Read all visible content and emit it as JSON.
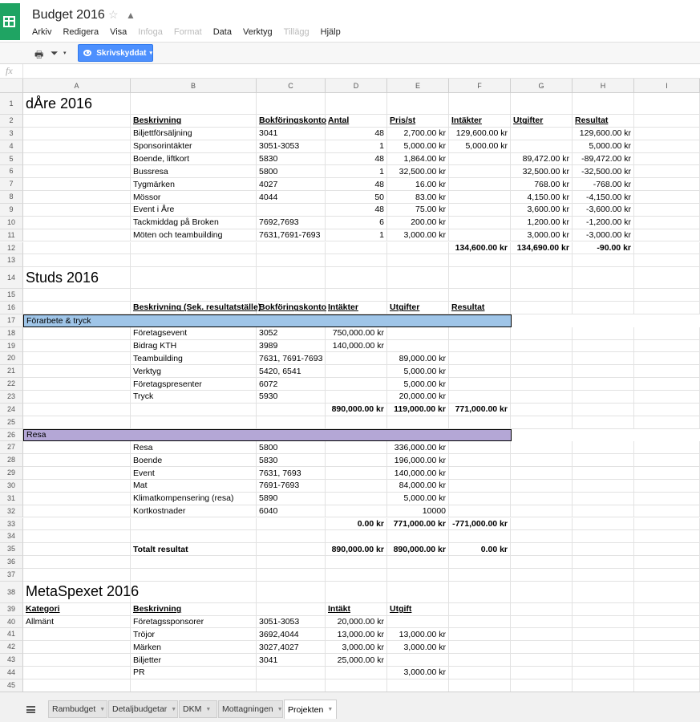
{
  "app": {
    "title": "Budget 2016"
  },
  "menu": [
    {
      "label": "Arkiv",
      "disabled": false
    },
    {
      "label": "Redigera",
      "disabled": false
    },
    {
      "label": "Visa",
      "disabled": false
    },
    {
      "label": "Infoga",
      "disabled": true
    },
    {
      "label": "Format",
      "disabled": true
    },
    {
      "label": "Data",
      "disabled": false
    },
    {
      "label": "Verktyg",
      "disabled": false
    },
    {
      "label": "Tillägg",
      "disabled": true
    },
    {
      "label": "Hjälp",
      "disabled": false
    }
  ],
  "toolbar": {
    "readonly_label": "Skrivskyddat"
  },
  "fx_label": "fx",
  "columns": [
    "A",
    "B",
    "C",
    "D",
    "E",
    "F",
    "G",
    "H",
    "I"
  ],
  "rows": {
    "1": {
      "A": "dÅre 2016"
    },
    "2": {
      "B": "Beskrivning",
      "C": "Bokföringskonto",
      "D": "Antal",
      "E": "Pris/st",
      "F": "Intäkter",
      "G": "Utgifter",
      "H": "Resultat"
    },
    "3": {
      "B": "Biljettförsäljning",
      "C": "3041",
      "D": "48",
      "E": "2,700.00 kr",
      "F": "129,600.00 kr",
      "H": "129,600.00 kr"
    },
    "4": {
      "B": "Sponsorintäkter",
      "C": "3051-3053",
      "D": "1",
      "E": "5,000.00 kr",
      "F": "5,000.00 kr",
      "H": "5,000.00 kr"
    },
    "5": {
      "B": "Boende, liftkort",
      "C": "5830",
      "D": "48",
      "E": "1,864.00 kr",
      "G": "89,472.00 kr",
      "H": "-89,472.00 kr"
    },
    "6": {
      "B": "Bussresa",
      "C": "5800",
      "D": "1",
      "E": "32,500.00 kr",
      "G": "32,500.00 kr",
      "H": "-32,500.00 kr"
    },
    "7": {
      "B": "Tygmärken",
      "C": "4027",
      "D": "48",
      "E": "16.00 kr",
      "G": "768.00 kr",
      "H": "-768.00 kr"
    },
    "8": {
      "B": "Mössor",
      "C": "4044",
      "D": "50",
      "E": "83.00 kr",
      "G": "4,150.00 kr",
      "H": "-4,150.00 kr"
    },
    "9": {
      "B": "Event i Åre",
      "D": "48",
      "E": "75.00 kr",
      "G": "3,600.00 kr",
      "H": "-3,600.00 kr"
    },
    "10": {
      "B": "Tackmiddag på Broken",
      "C": "7692,7693",
      "D": "6",
      "E": "200.00 kr",
      "G": "1,200.00 kr",
      "H": "-1,200.00 kr"
    },
    "11": {
      "B": "Möten och teambuilding",
      "C": "7631,7691-7693",
      "D": "1",
      "E": "3,000.00 kr",
      "G": "3,000.00 kr",
      "H": "-3,000.00 kr"
    },
    "12": {
      "F": "134,600.00 kr",
      "G": "134,690.00 kr",
      "H": "-90.00 kr"
    },
    "13": {},
    "14": {
      "A": "Studs 2016"
    },
    "15": {},
    "16": {
      "B": "Beskrivning  (Sek. resultatställe)",
      "C": "Bokföringskonto",
      "D": "Intäkter",
      "E": "Utgifter",
      "F": "Resultat"
    },
    "17": {
      "band": "Förarbete & tryck"
    },
    "18": {
      "B": "Företagsevent",
      "C": "3052",
      "D": "750,000.00 kr"
    },
    "19": {
      "B": "Bidrag KTH",
      "C": "3989",
      "D": "140,000.00 kr"
    },
    "20": {
      "B": "Teambuilding",
      "C": "7631, 7691-7693",
      "E": "89,000.00 kr"
    },
    "21": {
      "B": "Verktyg",
      "C": "5420, 6541",
      "E": "5,000.00 kr"
    },
    "22": {
      "B": "Företagspresenter",
      "C": "6072",
      "E": "5,000.00 kr"
    },
    "23": {
      "B": "Tryck",
      "C": "5930",
      "E": "20,000.00 kr"
    },
    "24": {
      "D": "890,000.00 kr",
      "E": "119,000.00 kr",
      "F": "771,000.00 kr"
    },
    "25": {},
    "26": {
      "band": "Resa"
    },
    "27": {
      "B": "Resa",
      "C": "5800",
      "E": "336,000.00 kr"
    },
    "28": {
      "B": "Boende",
      "C": "5830",
      "E": "196,000.00 kr"
    },
    "29": {
      "B": "Event",
      "C": "7631, 7693",
      "E": "140,000.00 kr"
    },
    "30": {
      "B": "Mat",
      "C": "7691-7693",
      "E": "84,000.00 kr"
    },
    "31": {
      "B": "Klimatkompensering (resa)",
      "C": "5890",
      "E": "5,000.00 kr"
    },
    "32": {
      "B": "Kortkostnader",
      "C": "6040",
      "E": "10000"
    },
    "33": {
      "D": "0.00 kr",
      "E": "771,000.00 kr",
      "F": "-771,000.00 kr"
    },
    "34": {},
    "35": {
      "B": "Totalt resultat",
      "D": "890,000.00 kr",
      "E": "890,000.00 kr",
      "F": "0.00 kr"
    },
    "36": {},
    "37": {},
    "38": {
      "A": "MetaSpexet 2016"
    },
    "39": {
      "A": "Kategori",
      "B": "Beskrivning",
      "D": "Intäkt",
      "E": "Utgift"
    },
    "40": {
      "A": "Allmänt",
      "B": "Företagssponsorer",
      "C": "3051-3053",
      "D": "20,000.00 kr"
    },
    "41": {
      "B": "Tröjor",
      "C": "3692,4044",
      "D": "13,000.00 kr",
      "E": "13,000.00 kr"
    },
    "42": {
      "B": "Märken",
      "C": "3027,4027",
      "D": "3,000.00 kr",
      "E": "3,000.00 kr"
    },
    "43": {
      "B": "Biljetter",
      "C": "3041",
      "D": "25,000.00 kr"
    },
    "44": {
      "B": "PR",
      "E": "3,000.00 kr"
    },
    "45": {}
  },
  "sheets": [
    {
      "label": "Rambudget",
      "active": false
    },
    {
      "label": "Detaljbudgetar",
      "active": false
    },
    {
      "label": "DKM",
      "active": false
    },
    {
      "label": "Mottagningen",
      "active": false
    },
    {
      "label": "Projekten",
      "active": true
    }
  ],
  "colors": {
    "band_blue": "#9fc5e8",
    "band_purple": "#b4a7d6",
    "accent": "#4d90fe",
    "logo_green": "#1fa463"
  }
}
